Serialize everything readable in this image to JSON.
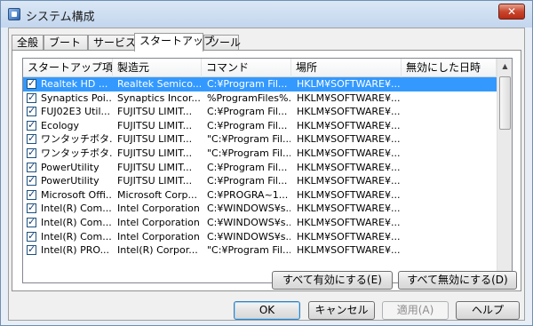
{
  "window": {
    "title": "システム構成",
    "close_label": "✕"
  },
  "tabs": [
    {
      "label": "全般"
    },
    {
      "label": "ブート"
    },
    {
      "label": "サービス"
    },
    {
      "label": "スタートアップ"
    },
    {
      "label": "ツール"
    }
  ],
  "startup_list": {
    "columns": [
      "スタートアップ項目",
      "製造元",
      "コマンド",
      "場所",
      "無効にした日時"
    ],
    "rows": [
      {
        "checked": true,
        "item": "Realtek HD ...",
        "maker": "Realtek Semico...",
        "command": "C:¥Program Fil...",
        "location": "HKLM¥SOFTWARE¥...",
        "disabled": ""
      },
      {
        "checked": true,
        "item": "Synaptics Poi...",
        "maker": "Synaptics Incor...",
        "command": "%ProgramFiles%...",
        "location": "HKLM¥SOFTWARE¥...",
        "disabled": ""
      },
      {
        "checked": true,
        "item": "FUJ02E3 Util...",
        "maker": "FUJITSU LIMIT...",
        "command": "C:¥Program Fil...",
        "location": "HKLM¥SOFTWARE¥...",
        "disabled": ""
      },
      {
        "checked": true,
        "item": "Ecology",
        "maker": "FUJITSU LIMIT...",
        "command": "C:¥Program Fil...",
        "location": "HKLM¥SOFTWARE¥...",
        "disabled": ""
      },
      {
        "checked": true,
        "item": "ワンタッチボタ...",
        "maker": "FUJITSU LIMIT...",
        "command": "\"C:¥Program Fil...",
        "location": "HKLM¥SOFTWARE¥...",
        "disabled": ""
      },
      {
        "checked": true,
        "item": "ワンタッチボタ...",
        "maker": "FUJITSU LIMIT...",
        "command": "\"C:¥Program Fil...",
        "location": "HKLM¥SOFTWARE¥...",
        "disabled": ""
      },
      {
        "checked": true,
        "item": "PowerUtility",
        "maker": "FUJITSU LIMIT...",
        "command": "C:¥Program Fil...",
        "location": "HKLM¥SOFTWARE¥...",
        "disabled": ""
      },
      {
        "checked": true,
        "item": "PowerUtility",
        "maker": "FUJITSU LIMIT...",
        "command": "C:¥Program Fil...",
        "location": "HKLM¥SOFTWARE¥...",
        "disabled": ""
      },
      {
        "checked": true,
        "item": "Microsoft Offi...",
        "maker": "Microsoft Corp...",
        "command": "C:¥PROGRA~1...",
        "location": "HKLM¥SOFTWARE¥...",
        "disabled": ""
      },
      {
        "checked": true,
        "item": "Intel(R) Com...",
        "maker": "Intel Corporation",
        "command": "C:¥WINDOWS¥s...",
        "location": "HKLM¥SOFTWARE¥...",
        "disabled": ""
      },
      {
        "checked": true,
        "item": "Intel(R) Com...",
        "maker": "Intel Corporation",
        "command": "C:¥WINDOWS¥s...",
        "location": "HKLM¥SOFTWARE¥...",
        "disabled": ""
      },
      {
        "checked": true,
        "item": "Intel(R) Com...",
        "maker": "Intel Corporation",
        "command": "C:¥WINDOWS¥s...",
        "location": "HKLM¥SOFTWARE¥...",
        "disabled": ""
      },
      {
        "checked": true,
        "item": "Intel(R) PRO...",
        "maker": "Intel(R) Corpor...",
        "command": "\"C:¥Program Fil...",
        "location": "HKLM¥SOFTWARE¥...",
        "disabled": ""
      }
    ]
  },
  "actions": {
    "enable_all": "すべて有効にする(E)",
    "disable_all": "すべて無効にする(D)"
  },
  "footer": {
    "ok": "OK",
    "cancel": "キャンセル",
    "apply": "適用(A)",
    "help": "ヘルプ"
  },
  "icons": {
    "app": "msconfig-icon",
    "scroll_up": "▲",
    "scroll_down": "▼"
  }
}
